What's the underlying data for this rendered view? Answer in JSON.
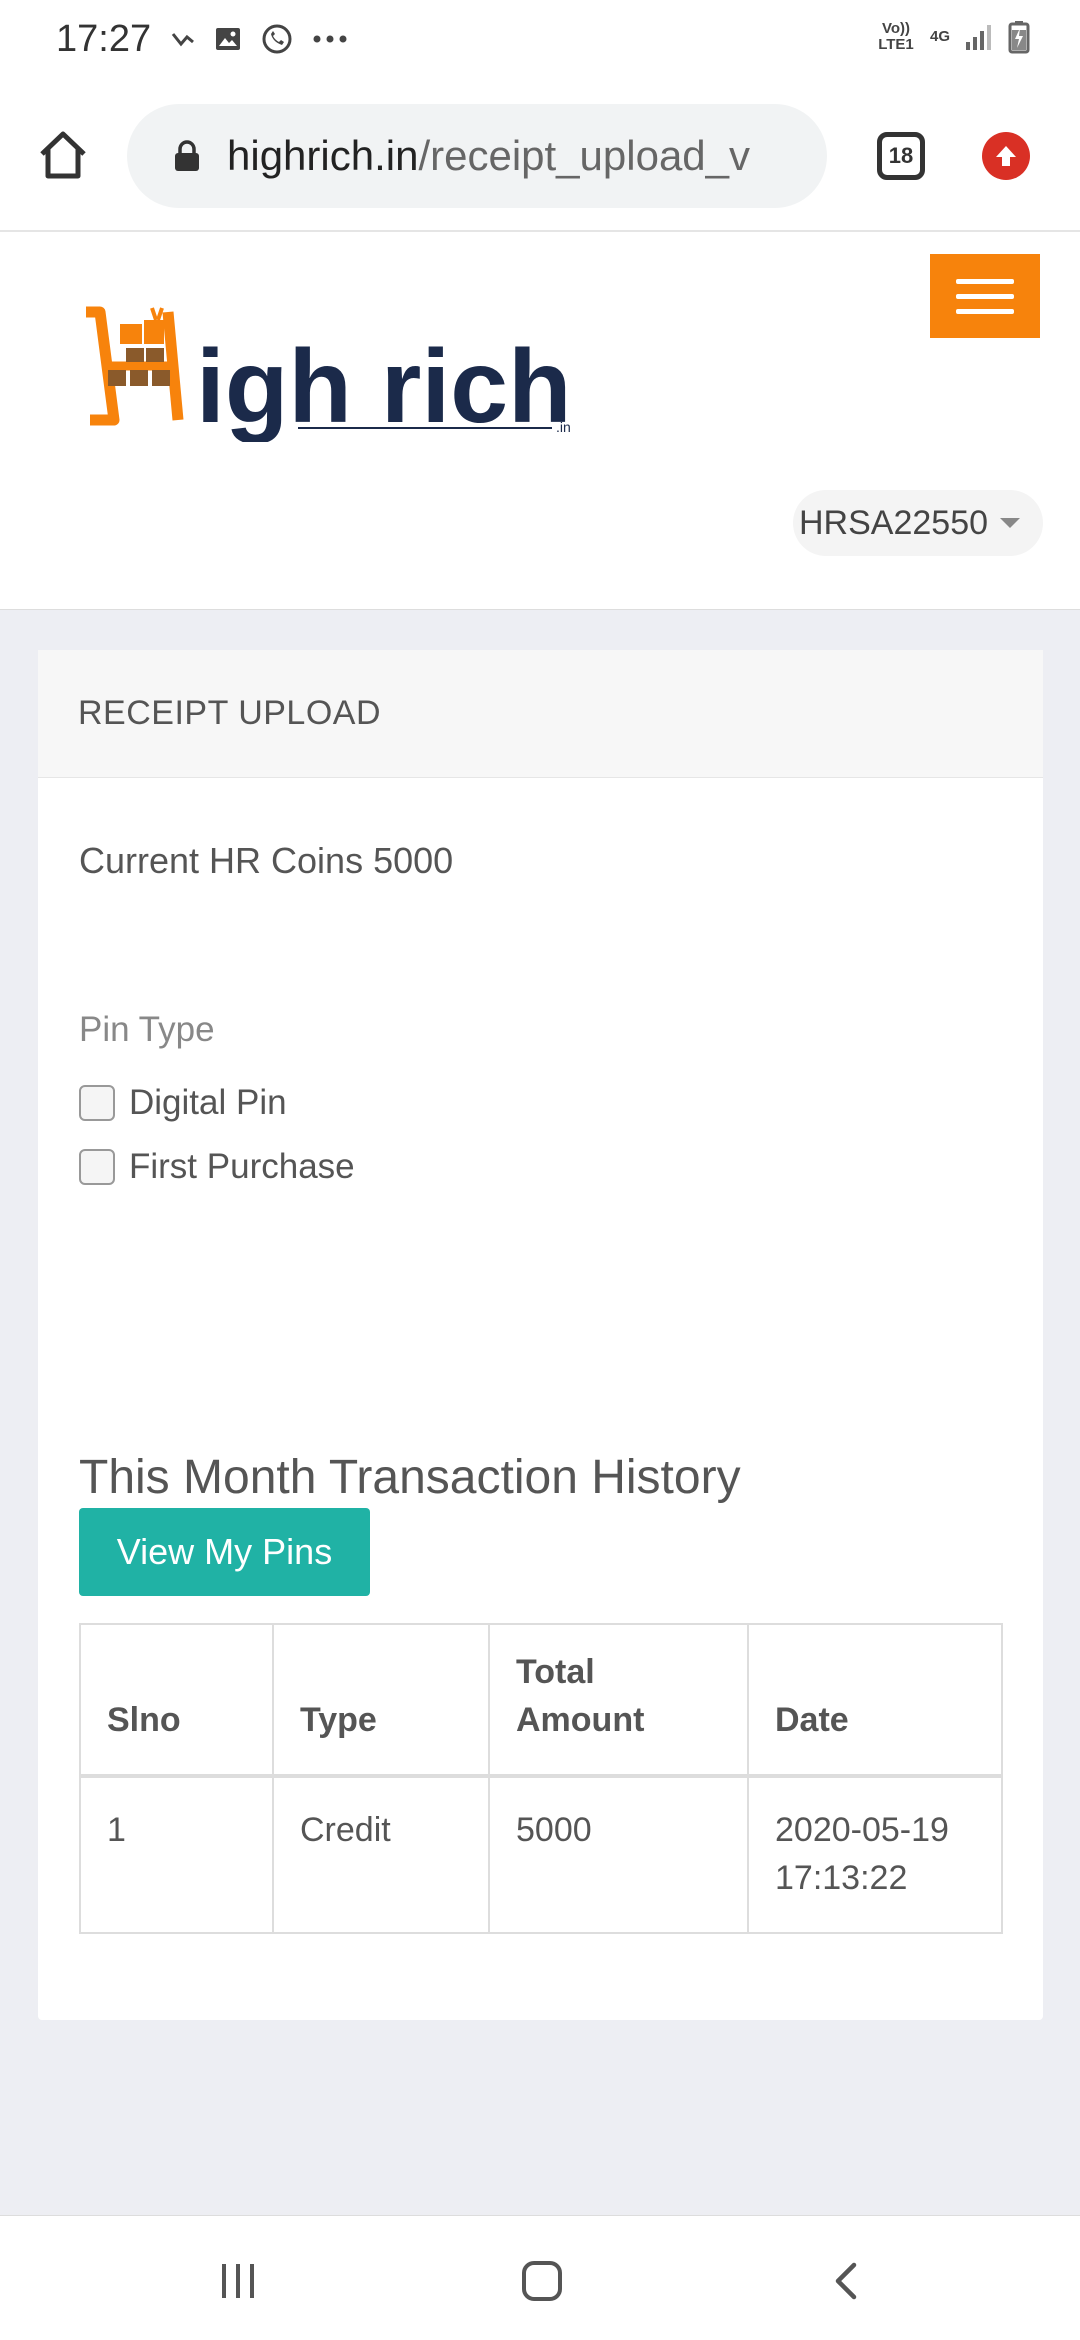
{
  "status_bar": {
    "time": "17:27",
    "network_top": "Vo)) LTE1",
    "network_type": "4G"
  },
  "browser": {
    "url_domain": "highrich.in",
    "url_path": "/receipt_upload_v",
    "tab_count": "18"
  },
  "header": {
    "logo_text": "igh rich",
    "logo_suffix": ".in",
    "user_id": "HRSA22550"
  },
  "card": {
    "title": "RECEIPT UPLOAD",
    "coins_text": "Current HR Coins 5000",
    "pin_type_label": "Pin Type",
    "pin_options": [
      "Digital Pin",
      "First Purchase"
    ],
    "history_title": "This Month Transaction History",
    "view_pins_label": "View My Pins"
  },
  "table": {
    "headers": [
      "Slno",
      "Type",
      "Total Amount",
      "Date"
    ],
    "rows": [
      [
        "1",
        "Credit",
        "5000",
        "2020-05-19 17:13:22"
      ]
    ]
  },
  "colors": {
    "accent_orange": "#f7830c",
    "button_teal": "#20b2a5",
    "logo_navy": "#1b2a4a"
  }
}
